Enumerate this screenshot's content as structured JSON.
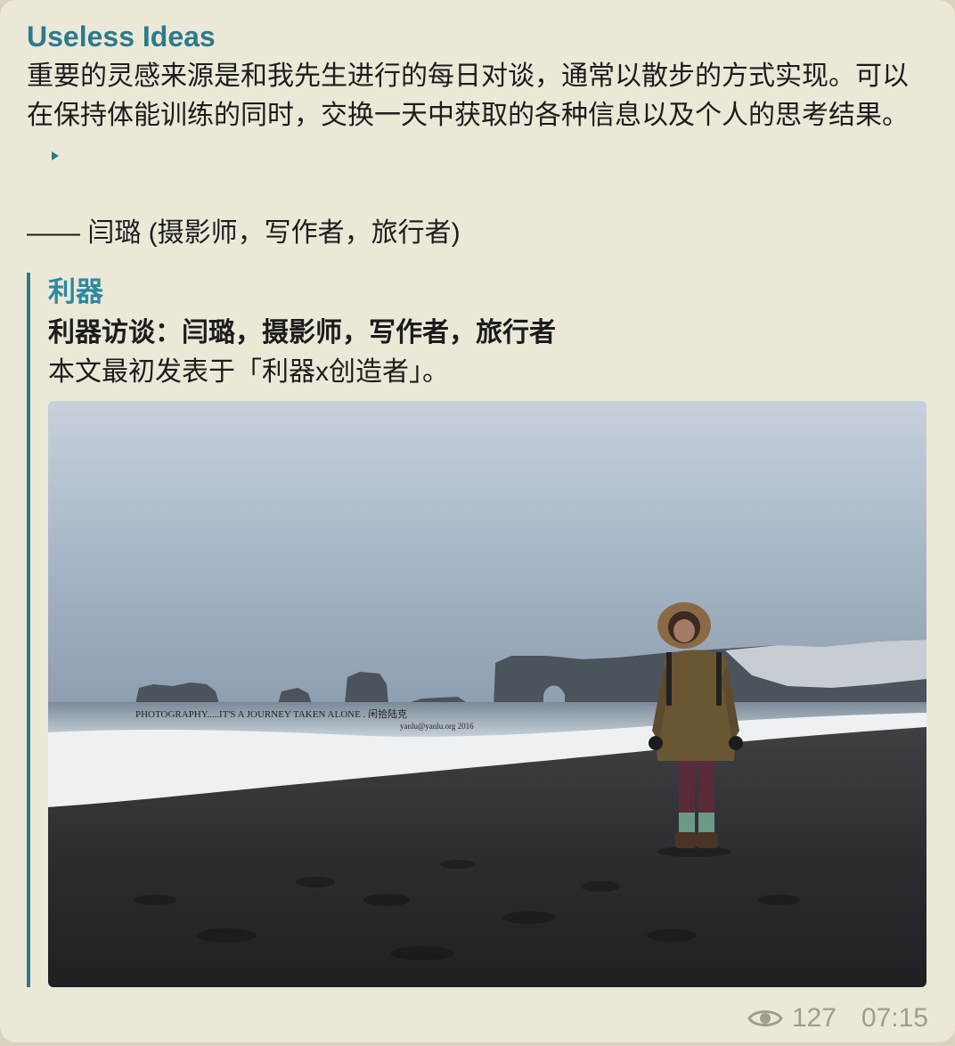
{
  "channel": {
    "name": "Useless Ideas"
  },
  "message": {
    "body": "重要的灵感来源是和我先生进行的每日对谈，通常以散步的方式实现。可以在保持体能训练的同时，交换一天中获取的各种信息以及个人的思考结果。",
    "attribution": "—— 闫璐 (摄影师，写作者，旅行者)"
  },
  "link_preview": {
    "site_name": "利器",
    "title": "利器访谈：闫璐，摄影师，写作者，旅行者",
    "description": "本文最初发表于「利器x创造者」。",
    "image": {
      "caption_line1": "PHOTOGRAPHY.....IT'S A JOURNEY TAKEN ALONE . 闲拾陆克",
      "caption_line2": "yanlu@yanlu.org 2016"
    }
  },
  "meta": {
    "views": "127",
    "time": "07:15"
  },
  "colors": {
    "bubble": "#ece8d8",
    "accent": "#2c7a8c",
    "meta_text": "#a19d8e"
  },
  "icons": {
    "expand": "expand-arrow-icon",
    "views": "eye-icon"
  }
}
